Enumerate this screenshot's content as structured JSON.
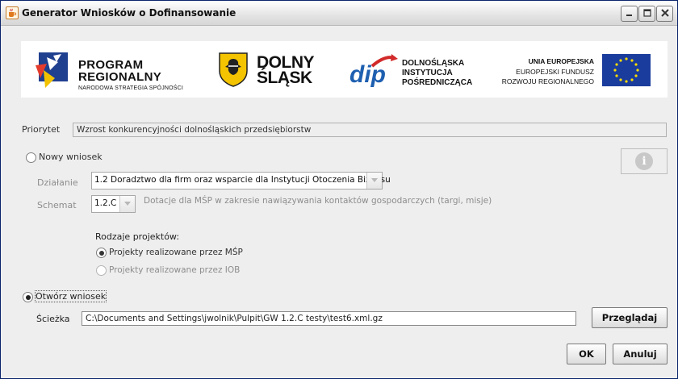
{
  "window": {
    "title": "Generator Wniosków o Dofinansowanie",
    "controls": [
      "minimize-icon",
      "maximize-icon",
      "close-icon"
    ]
  },
  "banner": {
    "program_line1": "PROGRAM",
    "program_line2": "REGIONALNY",
    "program_line3": "NARODOWA STRATEGIA SPÓJNOŚCI",
    "dolny_line1": "DOLNY",
    "dolny_line2": "ŚLĄSK",
    "dip_logo": "dip",
    "dip_line1": "DOLNOŚLĄSKA",
    "dip_line2": "INSTYTUCJA",
    "dip_line3": "POŚREDNICZĄCA",
    "ue_line1": "UNIA EUROPEJSKA",
    "ue_line2": "EUROPEJSKI FUNDUSZ",
    "ue_line3": "ROZWOJU REGIONALNEGO"
  },
  "form": {
    "priority_label": "Priorytet",
    "priority_value": "Wzrost konkurencyjności dolnośląskich przedsiębiorstw",
    "new_application_label": "Nowy wniosek",
    "new_application_selected": false,
    "action_label": "Działanie",
    "action_value": "1.2 Doradztwo dla firm oraz wsparcie dla Instytucji Otoczenia Biznesu",
    "scheme_label": "Schemat",
    "scheme_value": "1.2.C",
    "scheme_description": "Dotacje dla MŚP w zakresie nawiązywania kontaktów gospodarczych (targi, misje)",
    "project_types_label": "Rodzaje projektów:",
    "project_types": [
      {
        "label": "Projekty realizowane przez MŚP",
        "selected": true
      },
      {
        "label": "Projekty realizowane przez IOB",
        "selected": false
      }
    ],
    "open_application_label": "Otwórz wniosek",
    "open_application_selected": true,
    "path_label": "Ścieżka",
    "path_value": "C:\\Documents and Settings\\jwolnik\\Pulpit\\GW 1.2.C testy\\test6.xml.gz",
    "browse_label": "Przeglądaj",
    "info_icon": "info-icon"
  },
  "buttons": {
    "ok_label": "OK",
    "cancel_label": "Anuluj"
  },
  "colors": {
    "window_border": "#0a246a",
    "background": "#eeeeee",
    "eu_blue": "#1a3c9c",
    "eu_star": "#ffdd00",
    "dip_blue": "#1e5fb0",
    "dip_red": "#d22a2a"
  }
}
